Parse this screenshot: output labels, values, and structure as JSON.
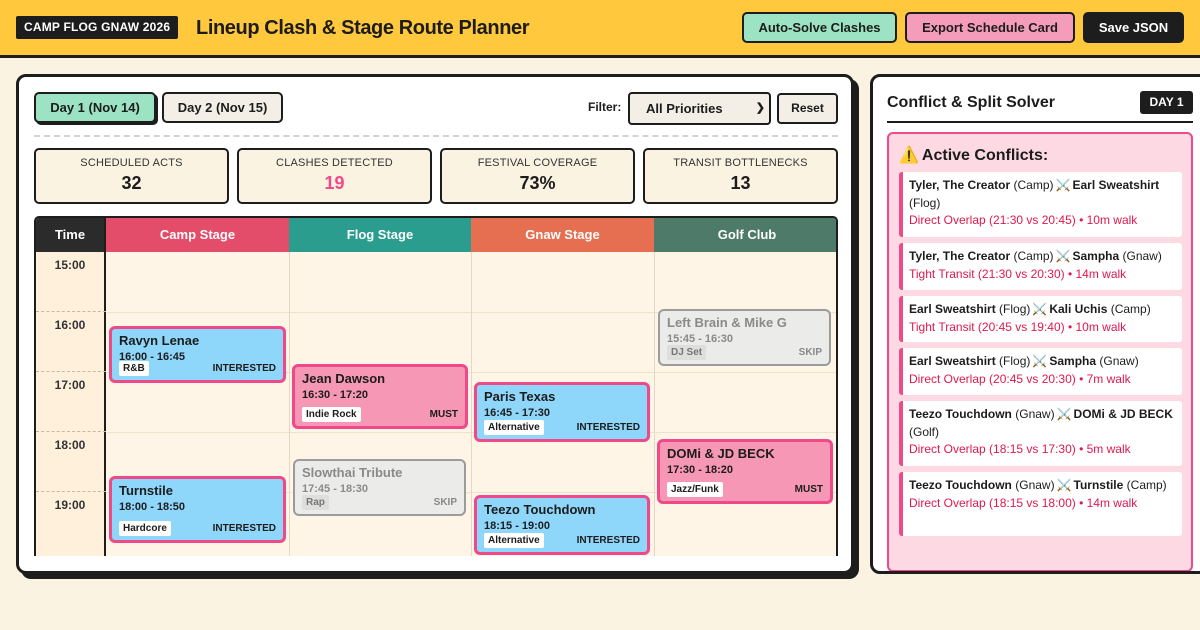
{
  "header": {
    "brand": "CAMP FLOG GNAW 2026",
    "title": "Lineup Clash & Stage Route Planner",
    "auto_solve": "Auto-Solve Clashes",
    "export": "Export Schedule Card",
    "save": "Save JSON"
  },
  "tabs": [
    "Day 1 (Nov 14)",
    "Day 2 (Nov 15)"
  ],
  "filter": {
    "label": "Filter:",
    "selected": "All Priorities",
    "reset": "Reset"
  },
  "stats": [
    {
      "label": "Scheduled Acts",
      "value": "32",
      "color": "#1c1c1c"
    },
    {
      "label": "Clashes Detected",
      "value": "19",
      "color": "#f0498a"
    },
    {
      "label": "Festival Coverage",
      "value": "73%",
      "color": "#1c1c1c"
    },
    {
      "label": "Transit Bottlenecks",
      "value": "13",
      "color": "#1c1c1c"
    }
  ],
  "grid": {
    "time_header": "Time",
    "stages": [
      {
        "name": "Camp Stage",
        "color": "#e34d6a"
      },
      {
        "name": "Flog Stage",
        "color": "#2a9d8f"
      },
      {
        "name": "Gnaw Stage",
        "color": "#e76f51"
      },
      {
        "name": "Golf Club",
        "color": "#4e7a6a"
      }
    ],
    "times": [
      "15:00",
      "16:00",
      "17:00",
      "18:00",
      "19:00"
    ]
  },
  "acts": [
    {
      "name": "Ravyn Lenae",
      "time": "16:00 - 16:45",
      "genre": "R&B",
      "priority": "INTERESTED",
      "style": "blue"
    },
    {
      "name": "Turnstile",
      "time": "18:00 - 18:50",
      "genre": "Hardcore",
      "priority": "INTERESTED",
      "style": "blue"
    },
    {
      "name": "Jean Dawson",
      "time": "16:30 - 17:20",
      "genre": "Indie Rock",
      "priority": "MUST",
      "style": "pink"
    },
    {
      "name": "Slowthai Tribute",
      "time": "17:45 - 18:30",
      "genre": "Rap",
      "priority": "SKIP",
      "style": "grey"
    },
    {
      "name": "Paris Texas",
      "time": "16:45 - 17:30",
      "genre": "Alternative",
      "priority": "INTERESTED",
      "style": "blue"
    },
    {
      "name": "Teezo Touchdown",
      "time": "18:15 - 19:00",
      "genre": "Alternative",
      "priority": "INTERESTED",
      "style": "blue"
    },
    {
      "name": "Left Brain & Mike G",
      "time": "15:45 - 16:30",
      "genre": "DJ Set",
      "priority": "SKIP",
      "style": "grey"
    },
    {
      "name": "DOMi & JD BECK",
      "time": "17:30 - 18:20",
      "genre": "Jazz/Funk",
      "priority": "MUST",
      "style": "pink"
    }
  ],
  "side": {
    "title": "Conflict & Split Solver",
    "day_badge": "DAY 1",
    "conflicts_title": "Active Conflicts:",
    "conflicts": [
      {
        "a": "Tyler, The Creator",
        "a_stage": "(Camp)",
        "b": "Earl Sweatshirt",
        "b_stage": "(Flog)",
        "reason": "Direct Overlap (21:30 vs 20:45) • 10m walk"
      },
      {
        "a": "Tyler, The Creator",
        "a_stage": "(Camp)",
        "b": "Sampha",
        "b_stage": "(Gnaw)",
        "reason": "Tight Transit (21:30 vs 20:30) • 14m walk"
      },
      {
        "a": "Earl Sweatshirt",
        "a_stage": "(Flog)",
        "b": "Kali Uchis",
        "b_stage": "(Camp)",
        "reason": "Tight Transit (20:45 vs 19:40) • 10m walk"
      },
      {
        "a": "Earl Sweatshirt",
        "a_stage": "(Flog)",
        "b": "Sampha",
        "b_stage": "(Gnaw)",
        "reason": "Direct Overlap (20:45 vs 20:30) • 7m walk"
      },
      {
        "a": "Teezo Touchdown",
        "a_stage": "(Gnaw)",
        "b": "DOMi & JD BECK",
        "b_stage": "(Golf)",
        "reason": "Direct Overlap (18:15 vs 17:30) • 5m walk"
      },
      {
        "a": "Teezo Touchdown",
        "a_stage": "(Gnaw)",
        "b": "Turnstile",
        "b_stage": "(Camp)",
        "reason": "Direct Overlap (18:15 vs 18:00) • 14m walk"
      }
    ]
  }
}
